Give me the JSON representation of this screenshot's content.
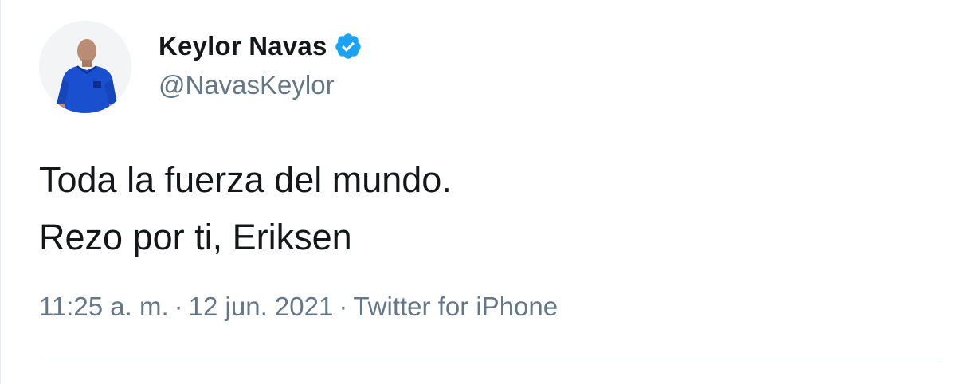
{
  "tweet": {
    "author": {
      "display_name": "Keylor Navas",
      "handle": "@NavasKeylor",
      "verified": true
    },
    "text_lines": [
      "Toda la fuerza del mundo.",
      "Rezo por ti, Eriksen"
    ],
    "meta": {
      "time": "11:25 a. m.",
      "separator": "·",
      "date": "12 jun. 2021",
      "source": "Twitter for iPhone"
    }
  },
  "colors": {
    "verified_badge": "#1da1f2",
    "secondary_text": "#657786",
    "primary_text": "#14171a",
    "jersey": "#1a4fd0"
  },
  "icons": {
    "verified": "verified-badge-icon",
    "avatar": "player-avatar"
  }
}
